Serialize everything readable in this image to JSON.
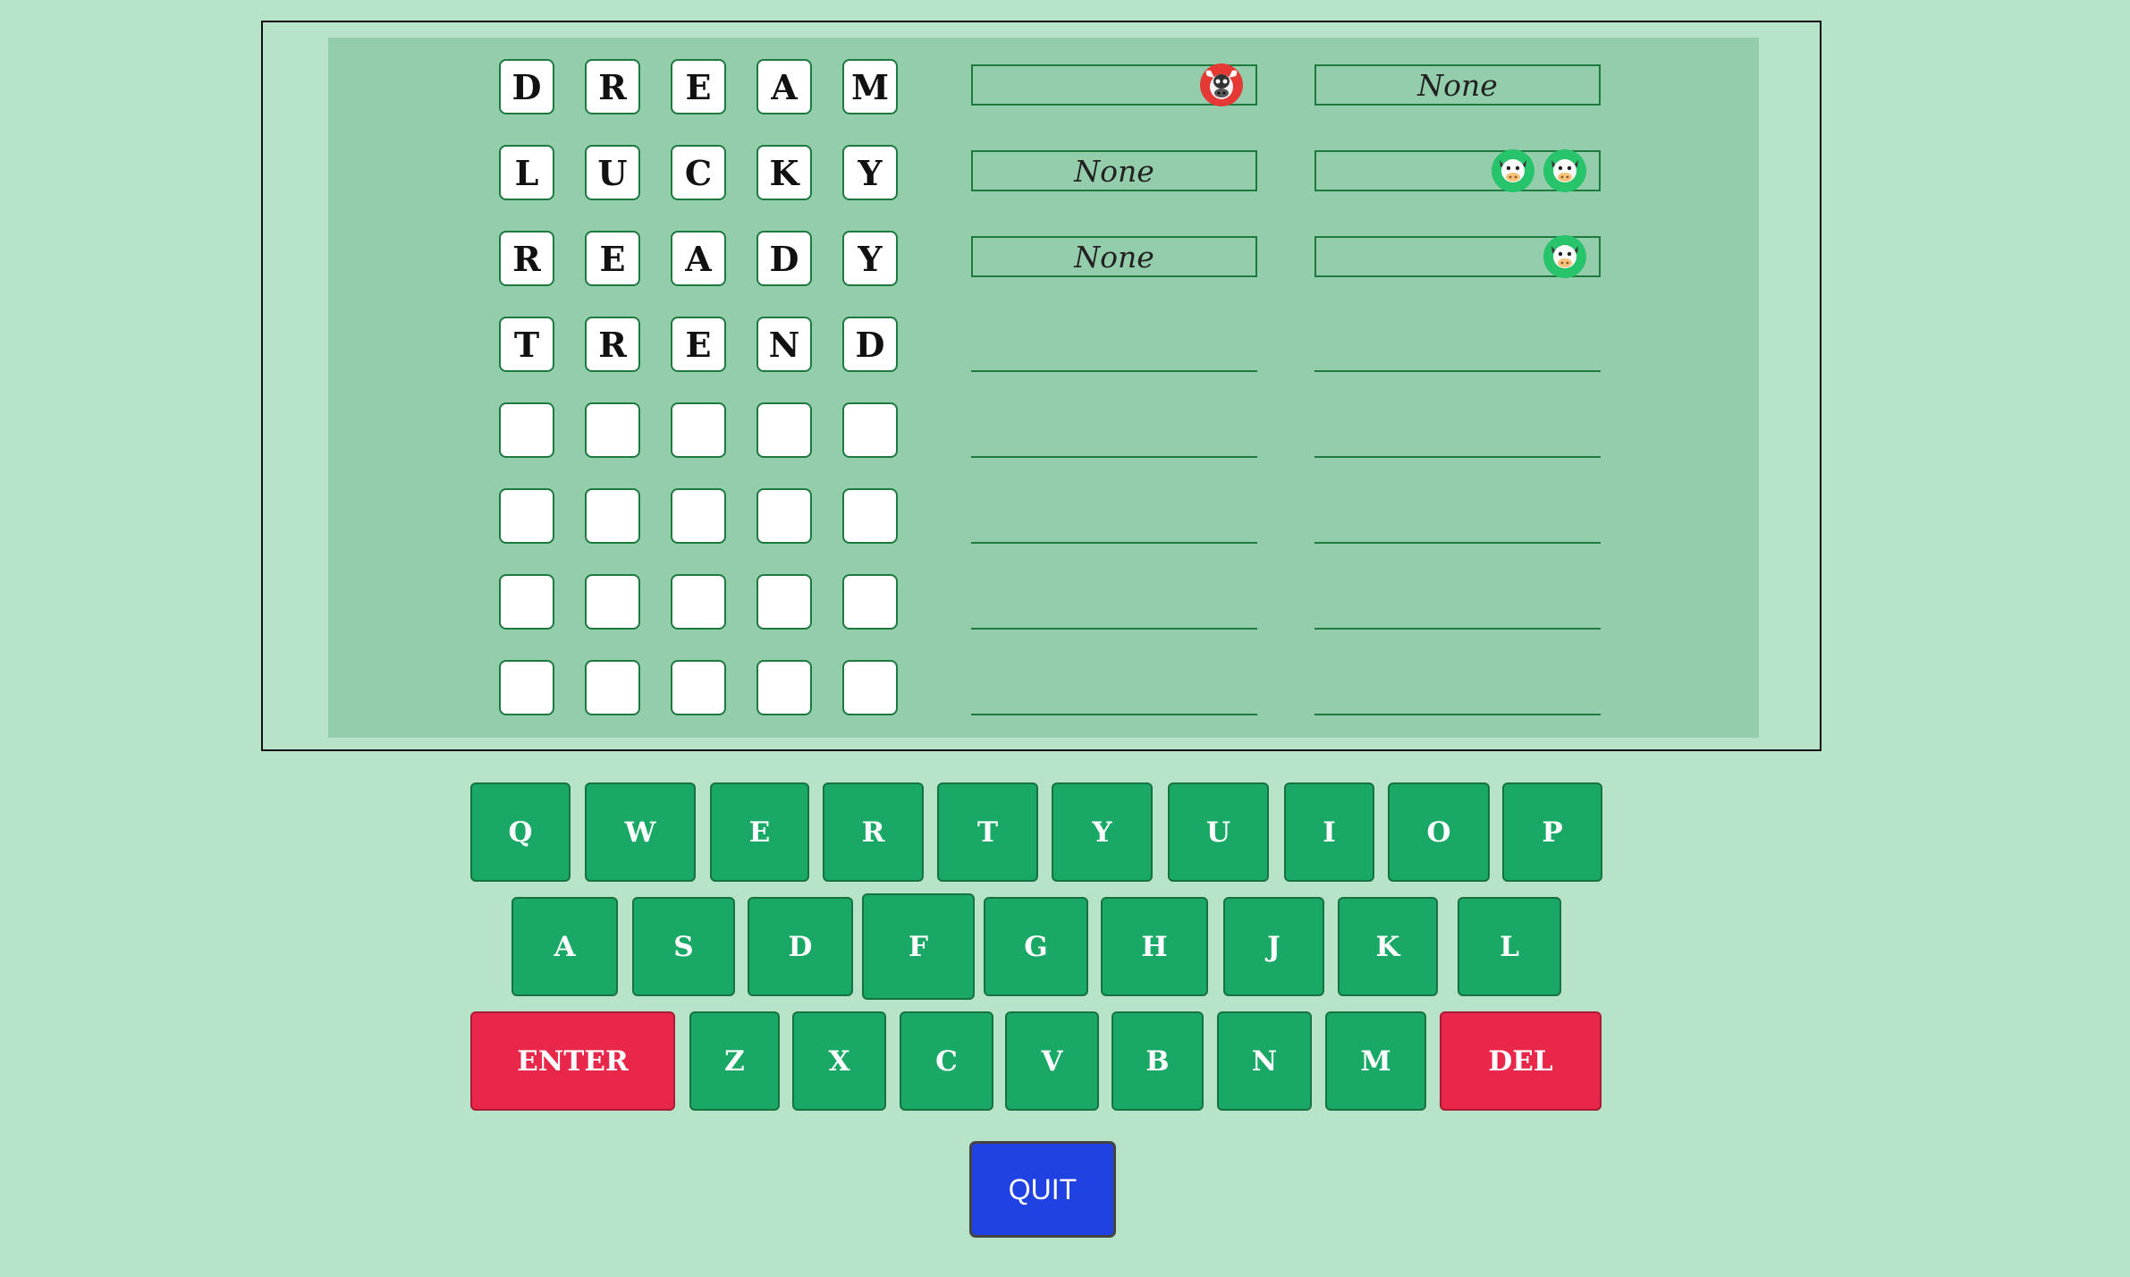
{
  "board": {
    "guesses": [
      {
        "letters": [
          "D",
          "R",
          "E",
          "A",
          "M"
        ],
        "bulls": {
          "text": "",
          "icons": [
            "bull-icon"
          ]
        },
        "cows": {
          "text": "None",
          "icons": []
        }
      },
      {
        "letters": [
          "L",
          "U",
          "C",
          "K",
          "Y"
        ],
        "bulls": {
          "text": "None",
          "icons": []
        },
        "cows": {
          "text": "",
          "icons": [
            "cow-icon",
            "cow-icon"
          ]
        }
      },
      {
        "letters": [
          "R",
          "E",
          "A",
          "D",
          "Y"
        ],
        "bulls": {
          "text": "None",
          "icons": []
        },
        "cows": {
          "text": "",
          "icons": [
            "cow-icon"
          ]
        }
      },
      {
        "letters": [
          "T",
          "R",
          "E",
          "N",
          "D"
        ],
        "bulls": null,
        "cows": null
      },
      {
        "letters": [
          "",
          "",
          "",
          "",
          ""
        ],
        "bulls": null,
        "cows": null
      },
      {
        "letters": [
          "",
          "",
          "",
          "",
          ""
        ],
        "bulls": null,
        "cows": null
      },
      {
        "letters": [
          "",
          "",
          "",
          "",
          ""
        ],
        "bulls": null,
        "cows": null
      },
      {
        "letters": [
          "",
          "",
          "",
          "",
          ""
        ],
        "bulls": null,
        "cows": null
      }
    ]
  },
  "keyboard": {
    "rows": [
      [
        "Q",
        "W",
        "E",
        "R",
        "T",
        "Y",
        "U",
        "I",
        "O",
        "P"
      ],
      [
        "A",
        "S",
        "D",
        "F",
        "G",
        "H",
        "J",
        "K",
        "L"
      ],
      [
        "ENTER",
        "Z",
        "X",
        "C",
        "V",
        "B",
        "N",
        "M",
        "DEL"
      ]
    ]
  },
  "quit_label": "QUIT",
  "colors": {
    "background": "#b7e3c8",
    "board": "#93cdab",
    "key": "#1aa866",
    "key_danger": "#e8274a",
    "quit": "#2142e3",
    "bull": "#e53935",
    "cow": "#27c46b"
  }
}
